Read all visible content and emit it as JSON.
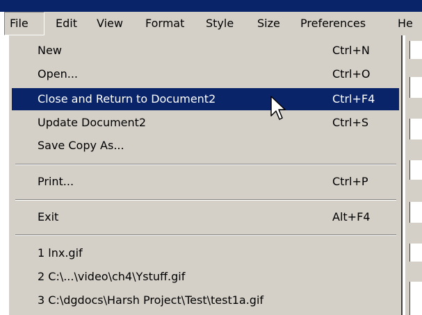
{
  "menubar": {
    "items": [
      "File",
      "Edit",
      "View",
      "Format",
      "Style",
      "Size",
      "Preferences",
      "He"
    ]
  },
  "file_menu": {
    "items": [
      {
        "label": "New",
        "shortcut": "Ctrl+N"
      },
      {
        "label": "Open...",
        "shortcut": "Ctrl+O"
      },
      {
        "label": "Close and Return to Document2",
        "shortcut": "Ctrl+F4"
      },
      {
        "label": "Update Document2",
        "shortcut": "Ctrl+S"
      },
      {
        "label": "Save Copy As...",
        "shortcut": ""
      },
      {
        "label": "Print...",
        "shortcut": "Ctrl+P"
      },
      {
        "label": "Exit",
        "shortcut": "Alt+F4"
      }
    ],
    "recent_files": [
      "1 lnx.gif",
      "2 C:\\...\\video\\ch4\\Ystuff.gif",
      "3 C:\\dgdocs\\Harsh Project\\Test\\test1a.gif"
    ],
    "highlighted_index": 2
  },
  "colors": {
    "menu_bg": "#d4d0c8",
    "highlight_bg": "#0a246a",
    "highlight_text": "#ffffff"
  },
  "icons": {
    "cursor": "mouse-pointer-icon"
  }
}
